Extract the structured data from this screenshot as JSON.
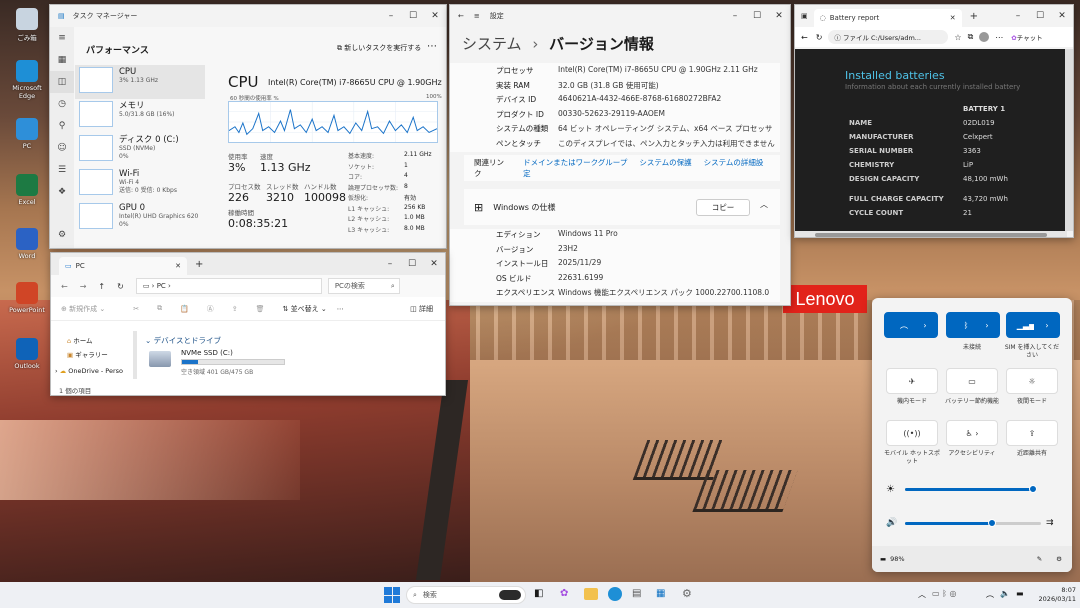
{
  "desktop_icons": [
    {
      "label": "ごみ箱",
      "color": "#c8d4e0"
    },
    {
      "label": "Microsoft Edge",
      "color": "#1e8fd6"
    },
    {
      "label": "PC",
      "color": "#2e8fd9"
    },
    {
      "label": "Excel",
      "color": "#1d7a43"
    },
    {
      "label": "Word",
      "color": "#2b62c4"
    },
    {
      "label": "PowerPoint",
      "color": "#d04526"
    },
    {
      "label": "Outlook",
      "color": "#0f63b8"
    }
  ],
  "task_manager": {
    "title": "タスク マネージャー",
    "heading": "パフォーマンス",
    "run_task": "新しいタスクを実行する",
    "items": [
      {
        "name": "CPU",
        "sub": "3%  1.13 GHz"
      },
      {
        "name": "メモリ",
        "sub": "5.0/31.8 GB (16%)"
      },
      {
        "name": "ディスク 0 (C:)",
        "sub": "SSD (NVMe)",
        "sub2": "0%"
      },
      {
        "name": "Wi-Fi",
        "sub": "Wi-Fi 4",
        "sub2": "送信: 0 受信: 0 Kbps"
      },
      {
        "name": "GPU 0",
        "sub": "Intel(R) UHD Graphics 620",
        "sub2": "0%"
      }
    ],
    "cpu_title": "CPU",
    "cpu_model": "Intel(R) Core(TM) i7-8665U CPU @ 1.90GHz",
    "graph_label": "60 秒間の使用率 %",
    "graph_max": "100%",
    "usage_label": "使用率",
    "usage": "3%",
    "speed_label": "速度",
    "speed": "1.13 GHz",
    "proc_label": "プロセス数",
    "procs": "226",
    "thread_label": "スレッド数",
    "threads": "3210",
    "handle_label": "ハンドル数",
    "handles": "100098",
    "uptime_label": "稼働時間",
    "uptime": "0:08:35:21",
    "specs": [
      {
        "k": "基本速度:",
        "v": "2.11 GHz"
      },
      {
        "k": "ソケット:",
        "v": "1"
      },
      {
        "k": "コア:",
        "v": "4"
      },
      {
        "k": "論理プロセッサ数:",
        "v": "8"
      },
      {
        "k": "仮想化:",
        "v": "有効"
      },
      {
        "k": "L1 キャッシュ:",
        "v": "256 KB"
      },
      {
        "k": "L2 キャッシュ:",
        "v": "1.0 MB"
      },
      {
        "k": "L3 キャッシュ:",
        "v": "8.0 MB"
      }
    ]
  },
  "settings": {
    "title": "設定",
    "crumb_root": "システム",
    "crumb_sep": "›",
    "crumb_page": "バージョン情報",
    "rows": [
      {
        "k": "プロセッサ",
        "v": "Intel(R) Core(TM) i7-8665U CPU @ 1.90GHz   2.11 GHz"
      },
      {
        "k": "実装 RAM",
        "v": "32.0 GB (31.8 GB 使用可能)"
      },
      {
        "k": "デバイス ID",
        "v": "4640621A-4432-466E-8768-61680272BFA2"
      },
      {
        "k": "プロダクト ID",
        "v": "00330-52623-29119-AAOEM"
      },
      {
        "k": "システムの種類",
        "v": "64 ビット オペレーティング システム、x64 ベース プロセッサ"
      },
      {
        "k": "ペンとタッチ",
        "v": "このディスプレイでは、ペン入力とタッチ入力は利用できません"
      }
    ],
    "related_label": "関連リンク",
    "links": [
      "ドメインまたはワークグループ",
      "システムの保護",
      "システムの詳細設定"
    ],
    "spec_title": "Windows の仕様",
    "copy": "コピー",
    "win_rows": [
      {
        "k": "エディション",
        "v": "Windows 11 Pro"
      },
      {
        "k": "バージョン",
        "v": "23H2"
      },
      {
        "k": "インストール日",
        "v": "2025/11/29"
      },
      {
        "k": "OS ビルド",
        "v": "22631.6199"
      },
      {
        "k": "エクスペリエンス",
        "v": "Windows 機能エクスペリエンス パック 1000.22700.1108.0"
      }
    ]
  },
  "battery": {
    "tab": "Battery report",
    "address": "ファイル   C:/Users/adm...",
    "chat": "チャット",
    "heading": "Installed batteries",
    "sub": "Information about each currently installed battery",
    "col": "BATTERY 1",
    "rows": [
      {
        "k": "NAME",
        "v": "02DL019"
      },
      {
        "k": "MANUFACTURER",
        "v": "Celxpert"
      },
      {
        "k": "SERIAL NUMBER",
        "v": "3363"
      },
      {
        "k": "CHEMISTRY",
        "v": "LiP"
      },
      {
        "k": "DESIGN CAPACITY",
        "v": "48,100 mWh"
      },
      {
        "k": "FULL CHARGE CAPACITY",
        "v": "43,720 mWh"
      },
      {
        "k": "CYCLE COUNT",
        "v": "21"
      }
    ]
  },
  "explorer": {
    "tab": "PC",
    "path": "PC",
    "search_ph": "PCの検索",
    "new": "新規作成",
    "sort": "並べ替え",
    "details": "詳細",
    "nav": [
      "ホーム",
      "ギャラリー",
      "OneDrive - Perso"
    ],
    "section": "デバイスとドライブ",
    "drive_name": "NVMe SSD (C:)",
    "drive_free": "空き領域 401 GB/475 GB",
    "drive_used_fraction": 0.16,
    "status": "1 個の項目"
  },
  "quick": {
    "labels": [
      "",
      "未接続",
      "SIM を挿入してください",
      "機内モード",
      "バッテリー節約機能",
      "夜間モード",
      "モバイル ホットスポット",
      "アクセシビリティ",
      "近距離共有"
    ],
    "brightness": 0.97,
    "volume": 0.64,
    "battery": "98%"
  },
  "lenovo": "Lenovo",
  "taskbar": {
    "search": "検索",
    "time": "8:07",
    "date": "2026/03/11"
  }
}
